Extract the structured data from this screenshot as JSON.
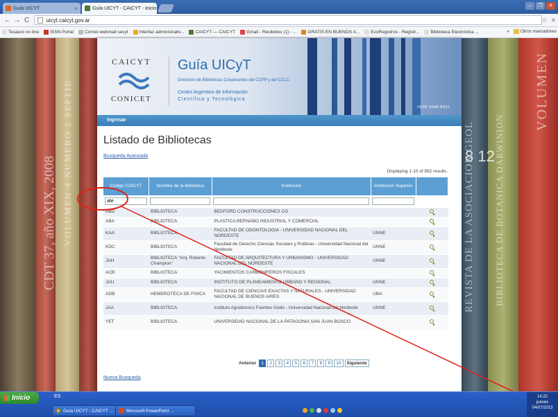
{
  "browser": {
    "tabs": [
      {
        "label": "Guía UICYT"
      },
      {
        "label": "Guía UICYT - CAICYT - Inicio"
      }
    ],
    "url": "uicyt.caicyt.gov.ar",
    "bookmarks": [
      "Tesauro on line",
      "ISSN Portal",
      "Correo webmail secyt",
      "Interfaz administrativ...",
      "CAICYT — CAICYT",
      "Gmail - Recibidos (1) - ...",
      "GRATIS EN BUENOS A...",
      "EcoRegistros - Registr...",
      "Biblioteca Electrónica ..."
    ],
    "bookmarks_overflow": "»",
    "other_bookmarks": "Otros marcadores"
  },
  "background_books": {
    "spine1": "CDT 37, año XIX, 2008",
    "spine2": "VOLUMEN 4 NUMERO 2 SEPTIE",
    "spine3": "REVISTA DE LA ASOCIACION GEOL",
    "spine4": "BIBLIOTECA DE BOTANICA DARWINION",
    "spine5": "8 12",
    "spine6": "VOLUMEN"
  },
  "header": {
    "caicyt": "CAICYT",
    "conicet": "CONICET",
    "title": "Guía UICyT",
    "subtitle": "Directorio de Bibliotecas Cooperantes del CCPP y del CCLC",
    "centro_line1": "Centro Argentino de Información",
    "centro_line2": "Científica y Tecnológica",
    "issn": "ISSN 1668-8001"
  },
  "menu": {
    "login": "Ingresar"
  },
  "main": {
    "title": "Listado de Bibliotecas",
    "advanced_search": "Busqueda Avanzada",
    "displaying": "Displaying 1-10 of 992 results.",
    "columns": [
      "Código CAICYT",
      "Nombre de la biblioteca",
      "Institución",
      "Institución Superior",
      ""
    ],
    "filter_value": "ate",
    "rows": [
      {
        "code": "ABD",
        "name": "BIBLIOTECA",
        "institution": "BEDFORD CONSTRUCCIONES CO",
        "superior": ""
      },
      {
        "code": "ABA",
        "name": "BIBLIOTECA",
        "institution": "PLASTICA BERNABO INDUSTRIAL Y COMERCIAL",
        "superior": ""
      },
      {
        "code": "KAA",
        "name": "BIBLIOTECA",
        "institution": "FACULTAD DE ODONTOLOGIA - UNIVERSIDAD NACIONAL DEL NORDESTE",
        "superior": "UNNE"
      },
      {
        "code": "KDC",
        "name": "BIBLIOTECA",
        "institution": "Facultad de Derecho Ciencias Sociales y Politicas - Universidad Nacional del Nordeste",
        "superior": "UNNE"
      },
      {
        "code": "JAH",
        "name": "BIBLIOTECA \"Arq. Roberto Champion\"",
        "institution": "FACULTAD DE ARQUITECTURA Y URBANISMO - UNIVERSIDAD NACIONAL DEL NORDESTE",
        "superior": "UNNE"
      },
      {
        "code": "ACB",
        "name": "BIBLIOTECA",
        "institution": "YACIMIENTOS CARBONIFEROS FISCALES",
        "superior": ""
      },
      {
        "code": "JAU",
        "name": "BIBLIOTECA",
        "institution": "INSTITUTO DE PLANEAMIENTO URBANO Y REGIONAL",
        "superior": "UNNE"
      },
      {
        "code": "ADB",
        "name": "HEMEROTECA DE FISICA",
        "institution": "FACULTAD DE CIENCIAS EXACTAS Y NATURALES - UNIVERSIDAD NACIONAL DE BUENOS AIRES",
        "superior": "UBA"
      },
      {
        "code": "JAA",
        "name": "BIBLIOTECA",
        "institution": "Instituto Agrotécnico Fuentes Godo - Universidad Nacional del Nordeste",
        "superior": "UNNE"
      },
      {
        "code": "YET",
        "name": "BIBLIOTECA",
        "institution": "UNIVERSIDAD NACIONAL DE LA PATAGONIA SAN JUAN BOSCO",
        "superior": ""
      }
    ],
    "pager": {
      "prev": "Anterior",
      "pages": [
        "1",
        "2",
        "3",
        "4",
        "5",
        "6",
        "7",
        "8",
        "9",
        "10"
      ],
      "next": "Siguiente"
    },
    "new_search": "Nueva Busqueda"
  },
  "taskbar": {
    "start": "Inicio",
    "lang": "ES",
    "items": [
      "Guía UICYT - CAICYT ...",
      "Microsoft PowerPoint ..."
    ],
    "clock_time": "14:22",
    "clock_day": "jueves",
    "clock_date": "04/07/2013"
  }
}
